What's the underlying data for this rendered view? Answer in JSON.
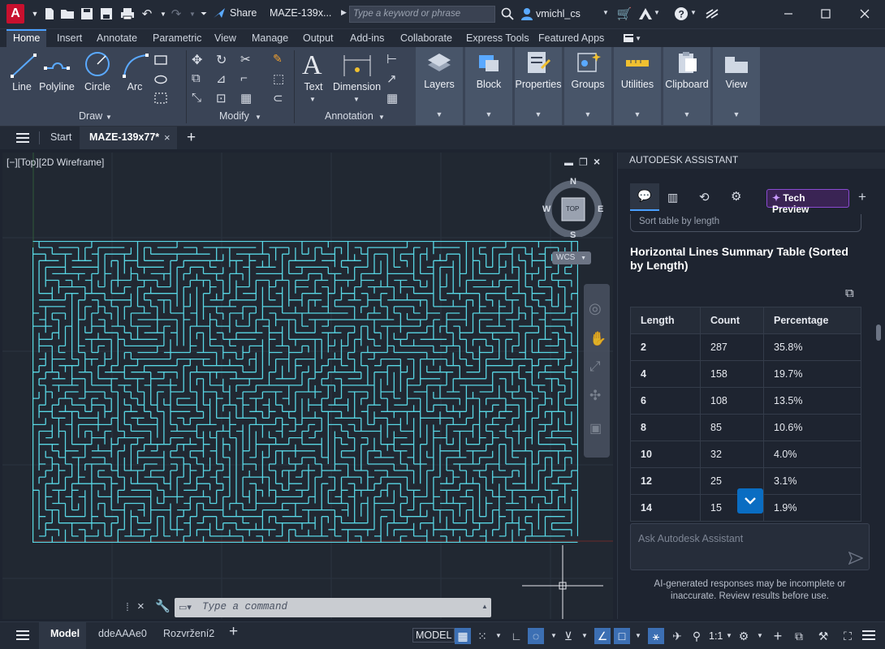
{
  "app": {
    "logo_letter": "A",
    "share_label": "Share",
    "doc_title": "MAZE-139x...",
    "search_placeholder": "Type a keyword or phrase",
    "username": "vmichl_cs",
    "accent": "#4aa0ff",
    "brand": "#c8102e"
  },
  "menu_tabs": [
    "Home",
    "Insert",
    "Annotate",
    "Parametric",
    "View",
    "Manage",
    "Output",
    "Add-ins",
    "Collaborate",
    "Express Tools",
    "Featured Apps"
  ],
  "ribbon": {
    "draw_tools": [
      "Line",
      "Polyline",
      "Circle",
      "Arc"
    ],
    "panels": {
      "draw": "Draw",
      "modify": "Modify",
      "annotation": "Annotation"
    },
    "annotation_tools": [
      "Text",
      "Dimension"
    ],
    "big_panels": [
      "Layers",
      "Block",
      "Properties",
      "Groups",
      "Utilities",
      "Clipboard",
      "View"
    ]
  },
  "file_tabs": {
    "start": "Start",
    "active": "MAZE-139x77*"
  },
  "viewport": {
    "label": "[−][Top][2D Wireframe]",
    "viewcube": {
      "top": "TOP",
      "north": "N",
      "south": "S",
      "east": "E",
      "west": "W",
      "wcs": "WCS"
    },
    "maze_color": "#58d6e4",
    "command_placeholder": "Type a command"
  },
  "assistant": {
    "header": "AUTODESK ASSISTANT",
    "tech_preview": "Tech Preview",
    "prev_bubble": "Sort table by length",
    "title": "Horizontal Lines Summary Table (Sorted by Length)",
    "columns": [
      "Length",
      "Count",
      "Percentage"
    ],
    "rows": [
      [
        "2",
        "287",
        "35.8%"
      ],
      [
        "4",
        "158",
        "19.7%"
      ],
      [
        "6",
        "108",
        "13.5%"
      ],
      [
        "8",
        "85",
        "10.6%"
      ],
      [
        "10",
        "32",
        "4.0%"
      ],
      [
        "12",
        "25",
        "3.1%"
      ],
      [
        "14",
        "15",
        "1.9%"
      ]
    ],
    "input_placeholder": "Ask Autodesk Assistant",
    "disclaimer": "AI-generated responses may be incomplete or inaccurate. Review results before use."
  },
  "status": {
    "tabs": [
      "Model",
      "ddeAAAe0",
      "Rozvržení2"
    ],
    "model_label": "MODEL",
    "scale": "1:1"
  }
}
